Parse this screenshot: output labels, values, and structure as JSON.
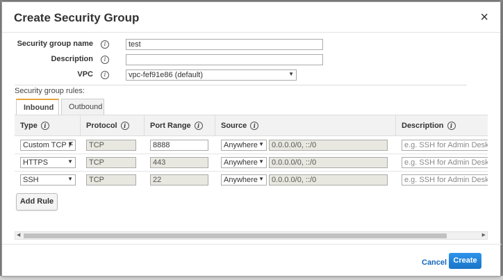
{
  "dialog": {
    "title": "Create Security Group",
    "close_glyph": "×"
  },
  "form": {
    "name_label": "Security group name",
    "name_value": "test",
    "description_label": "Description",
    "description_value": "",
    "vpc_label": "VPC",
    "vpc_value": "vpc-fef91e86 (default)",
    "info_glyph": "i"
  },
  "rules": {
    "section_label": "Security group rules:",
    "tabs": [
      {
        "label": "Inbound",
        "active": true
      },
      {
        "label": "Outbound",
        "active": false
      }
    ],
    "headers": [
      "Type",
      "Protocol",
      "Port Range",
      "Source",
      "Description"
    ],
    "rows": [
      {
        "type": "Custom TCP F",
        "protocol": "TCP",
        "port": "8888",
        "source": "Anywhere",
        "cidr": "0.0.0.0/0, ::/0",
        "description_placeholder": "e.g. SSH for Admin Desktop"
      },
      {
        "type": "HTTPS",
        "protocol": "TCP",
        "port": "443",
        "source": "Anywhere",
        "cidr": "0.0.0.0/0, ::/0",
        "description_placeholder": "e.g. SSH for Admin Desktop"
      },
      {
        "type": "SSH",
        "protocol": "TCP",
        "port": "22",
        "source": "Anywhere",
        "cidr": "0.0.0.0/0, ::/0",
        "description_placeholder": "e.g. SSH for Admin Desktop"
      }
    ],
    "add_rule_label": "Add Rule"
  },
  "footer": {
    "cancel_label": "Cancel",
    "create_label": "Create"
  },
  "colors": {
    "accent": "#1e88e5",
    "tab_active": "#e7a33e",
    "link": "#1166bb"
  }
}
